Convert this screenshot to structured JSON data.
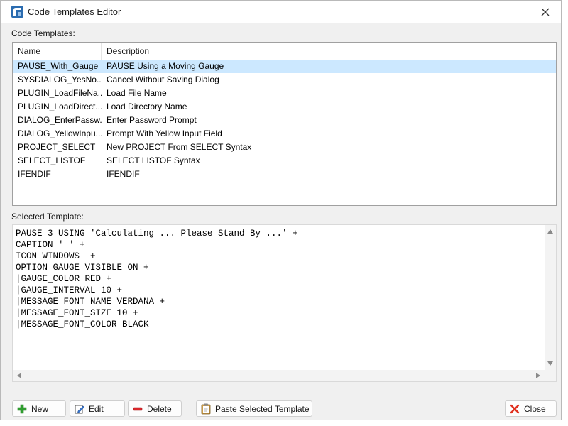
{
  "window": {
    "title": "Code Templates Editor"
  },
  "labels": {
    "code_templates": "Code Templates:",
    "selected_template": "Selected Template:"
  },
  "list": {
    "columns": [
      "Name",
      "Description"
    ],
    "rows": [
      {
        "name": "PAUSE_With_Gauge",
        "description": "PAUSE Using a Moving Gauge",
        "selected": true
      },
      {
        "name": "SYSDIALOG_YesNo...",
        "description": "Cancel Without Saving Dialog"
      },
      {
        "name": "PLUGIN_LoadFileNa...",
        "description": "Load File Name"
      },
      {
        "name": "PLUGIN_LoadDirect...",
        "description": "Load Directory Name"
      },
      {
        "name": "DIALOG_EnterPassw...",
        "description": "Enter Password Prompt"
      },
      {
        "name": "DIALOG_YellowInpu...",
        "description": "Prompt With Yellow Input Field"
      },
      {
        "name": "PROJECT_SELECT",
        "description": "New PROJECT From SELECT Syntax"
      },
      {
        "name": "SELECT_LISTOF",
        "description": "SELECT LISTOF Syntax"
      },
      {
        "name": "IFENDIF",
        "description": "IFENDIF"
      }
    ]
  },
  "editor": {
    "code": "PAUSE 3 USING 'Calculating ... Please Stand By ...' +\nCAPTION ' ' +\nICON WINDOWS  +\nOPTION GAUGE_VISIBLE ON +\n|GAUGE_COLOR RED +\n|GAUGE_INTERVAL 10 +\n|MESSAGE_FONT_NAME VERDANA +\n|MESSAGE_FONT_SIZE 10 +\n|MESSAGE_FONT_COLOR BLACK"
  },
  "buttons": {
    "new": "New",
    "edit": "Edit",
    "delete": "Delete",
    "paste": "Paste Selected Template",
    "close": "Close"
  },
  "colors": {
    "selection": "#cce8ff",
    "new_icon": "#2e9d2e",
    "delete_icon": "#d9262a",
    "close_icon": "#e0301e"
  }
}
